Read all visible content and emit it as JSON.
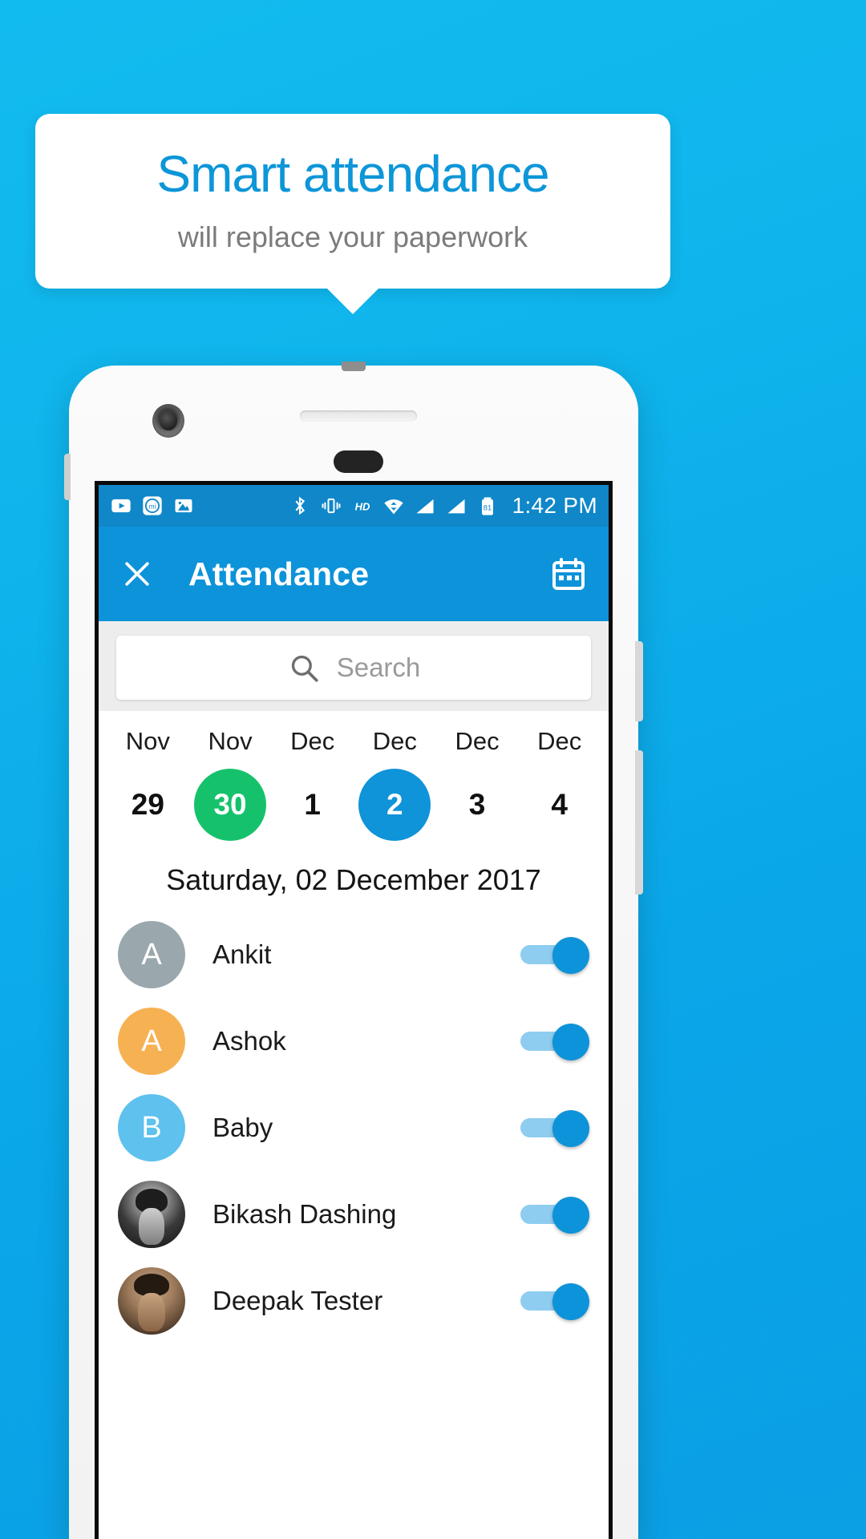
{
  "promo": {
    "title": "Smart attendance",
    "subtitle": "will replace your paperwork",
    "title_color": "#0d96d8",
    "subtitle_color": "#7b7b7b",
    "background_color": "#0fb4ec"
  },
  "status_bar": {
    "time": "1:42 PM",
    "battery_level": "81",
    "left_icons": [
      "youtube-icon",
      "mi-store-icon",
      "gallery-icon"
    ],
    "right_icons": [
      "bluetooth-icon",
      "vibrate-icon",
      "hd-icon",
      "wifi-icon",
      "signal-1-icon",
      "signal-2-icon",
      "battery-icon"
    ],
    "background_color": "#0f87c8"
  },
  "app_bar": {
    "close_label": "×",
    "title": "Attendance",
    "calendar_icon": "calendar-icon",
    "background_color": "#0d93d9"
  },
  "search": {
    "placeholder": "Search",
    "value": "",
    "icon": "search-icon"
  },
  "date_strip": {
    "days": [
      {
        "month": "Nov",
        "day": "29",
        "state": "normal"
      },
      {
        "month": "Nov",
        "day": "30",
        "state": "today"
      },
      {
        "month": "Dec",
        "day": "1",
        "state": "normal"
      },
      {
        "month": "Dec",
        "day": "2",
        "state": "selected"
      },
      {
        "month": "Dec",
        "day": "3",
        "state": "normal"
      },
      {
        "month": "Dec",
        "day": "4",
        "state": "normal"
      }
    ],
    "today_color": "#15c26b",
    "selected_color": "#0f93d9"
  },
  "selected_date_title": "Saturday, 02 December 2017",
  "attendance_list": [
    {
      "name": "Ankit",
      "avatar_type": "initial",
      "initial": "A",
      "avatar_color": "#9aa8ae",
      "present": true
    },
    {
      "name": "Ashok",
      "avatar_type": "initial",
      "initial": "A",
      "avatar_color": "#f6b153",
      "present": true
    },
    {
      "name": "Baby",
      "avatar_type": "initial",
      "initial": "B",
      "avatar_color": "#5ec1ee",
      "present": true
    },
    {
      "name": "Bikash Dashing",
      "avatar_type": "photo",
      "initial": "",
      "avatar_color": "#2b2b2b",
      "present": true
    },
    {
      "name": "Deepak Tester",
      "avatar_type": "photo",
      "initial": "",
      "avatar_color": "#6b5140",
      "present": true
    }
  ]
}
